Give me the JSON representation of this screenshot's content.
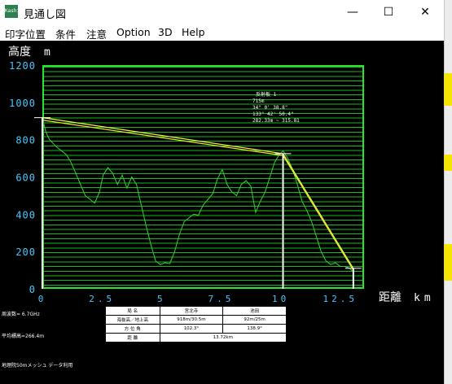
{
  "window": {
    "icon_text": "Kashi",
    "title": "見通し図",
    "minimize_glyph": "—",
    "maximize_glyph": "☐",
    "close_glyph": "✕"
  },
  "menu": [
    "印字位置",
    "条件",
    "注意",
    "Option",
    "3D",
    "Help"
  ],
  "chart_data": {
    "type": "line",
    "ylabel_text": "高度",
    "ylabel_unit": "m",
    "xlabel_text": "距離",
    "xlabel_unit": "km",
    "y_ticks": [
      "1200",
      "1000",
      "800",
      "600",
      "400",
      "200",
      "0"
    ],
    "x_ticks": [
      "0",
      "2.5",
      "5",
      "7.5",
      "10",
      "12.5"
    ],
    "xlim": [
      0,
      13.5
    ],
    "ylim": [
      0,
      1200
    ],
    "grid": true,
    "series": [
      {
        "role": "terrain",
        "color": "#33d633",
        "x": [
          0,
          0.15,
          0.3,
          0.6,
          1.0,
          1.2,
          1.4,
          1.6,
          1.8,
          2.0,
          2.2,
          2.4,
          2.55,
          2.75,
          2.95,
          3.15,
          3.35,
          3.55,
          3.75,
          3.95,
          4.15,
          4.35,
          4.55,
          4.75,
          4.95,
          5.15,
          5.35,
          5.55,
          5.75,
          5.95,
          6.15,
          6.35,
          6.55,
          6.75,
          6.95,
          7.15,
          7.35,
          7.55,
          7.75,
          7.95,
          8.15,
          8.35,
          8.55,
          8.75,
          8.95,
          9.15,
          9.35,
          9.55,
          9.75,
          9.95,
          10.1,
          10.3,
          10.5,
          10.7,
          10.9,
          11.1,
          11.3,
          11.5,
          11.7,
          11.9,
          12.1,
          12.3,
          12.5,
          12.7,
          12.9,
          13.05
        ],
        "y": [
          918,
          840,
          800,
          760,
          720,
          680,
          620,
          560,
          500,
          480,
          460,
          520,
          610,
          650,
          620,
          560,
          610,
          540,
          600,
          560,
          450,
          340,
          240,
          150,
          130,
          140,
          135,
          200,
          290,
          360,
          380,
          400,
          395,
          450,
          480,
          510,
          590,
          640,
          560,
          520,
          500,
          560,
          580,
          550,
          410,
          470,
          520,
          600,
          680,
          720,
          740,
          700,
          640,
          560,
          470,
          420,
          360,
          280,
          200,
          150,
          130,
          140,
          120,
          120,
          110,
          90
        ]
      },
      {
        "role": "sightline",
        "color": "#f4f44a",
        "x": [
          0,
          10.1,
          13.05
        ],
        "y": [
          918,
          725,
          110
        ]
      },
      {
        "role": "sightline-offset",
        "color": "#e8e830",
        "x": [
          0,
          10.1,
          13.05
        ],
        "y": [
          905,
          715,
          100
        ]
      }
    ],
    "markers": [
      {
        "x": 0,
        "y": 918
      },
      {
        "x": 10.1,
        "y": 725
      },
      {
        "x": 13.05,
        "y": 110
      }
    ],
    "annotation": [
      "反射板 1",
      "715m",
      "34° 0' 38.8\"",
      "133° 42' 50.4\"",
      "282.33m ~ 315.81"
    ]
  },
  "info": {
    "frequency": "周波数= 6.7GHz",
    "average_elevation": "平均標高=266.4m",
    "mesh": "地理院50mメッシュ データ利用"
  },
  "result_table": {
    "header": [
      "局 名",
      "宮北寺",
      "池田"
    ],
    "rows": [
      [
        "海抜高／地上高",
        "918m/30.5m",
        "92m/25m"
      ],
      [
        "方 位 角",
        "102.3°",
        "138.9°"
      ]
    ],
    "distance_label": "距 離",
    "distance_value": "13.72km"
  },
  "colors": {
    "background": "#000000",
    "grid": "#28e628",
    "tick_labels": "#49c8ff",
    "axis_title": "#ffffff",
    "poles": "#ffffff",
    "side_strip_highlight": "#f5e500"
  }
}
